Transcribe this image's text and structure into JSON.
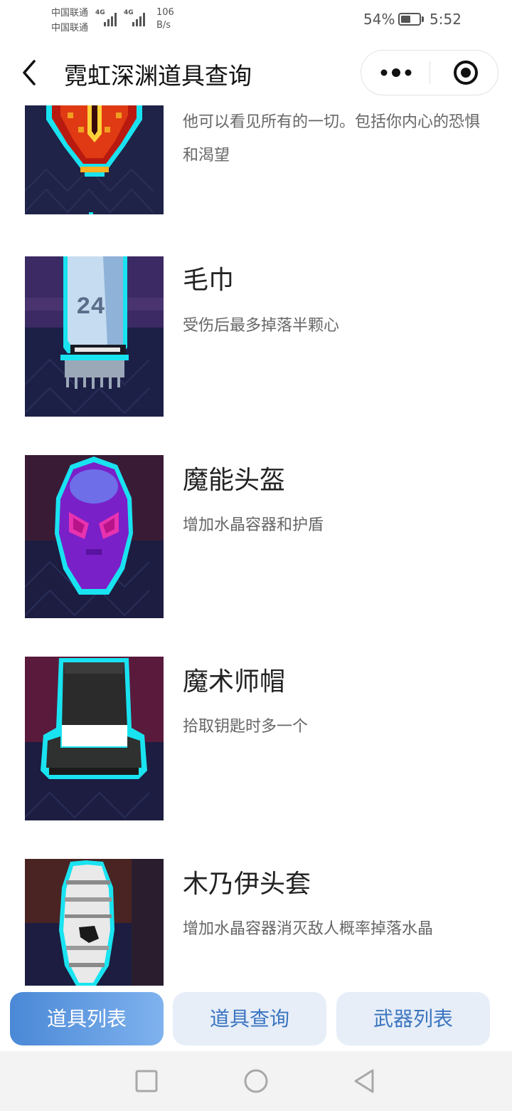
{
  "status_bar": {
    "carrier_1": "中国联通",
    "carrier_2": "中国联通",
    "network_1": "4G",
    "network_2": "4G",
    "net_speed_value": "106",
    "net_speed_unit": "B/s",
    "battery_percent": "54%",
    "battery_level": 0.54,
    "time": "5:52"
  },
  "nav": {
    "title": "霓虹深渊道具查询",
    "icons": {
      "back": "chevron-left-icon",
      "more": "more-dots-icon",
      "close": "target-circle-icon"
    }
  },
  "items": [
    {
      "name": "",
      "description": "他可以看见所有的一切。包括你内心的恐惧和渴望",
      "icon": "crimson-eye-crown-item",
      "bg_top": "#1f2347",
      "bg_bottom": "#1f2347"
    },
    {
      "name": "毛巾",
      "description": "受伤后最多掉落半颗心",
      "icon": "towel-item",
      "bg_top": "#3b2a63",
      "bg_bottom": "#1d2046"
    },
    {
      "name": "魔能头盔",
      "description": "增加水晶容器和护盾",
      "icon": "purple-helmet-item",
      "bg_top": "#3a1b36",
      "bg_bottom": "#1c1d40"
    },
    {
      "name": "魔术师帽",
      "description": "拾取钥匙时多一个",
      "icon": "magician-hat-item",
      "bg_top": "#5a1a3c",
      "bg_bottom": "#1c1d40"
    },
    {
      "name": "木乃伊头套",
      "description": "增加水晶容器消灭敌人概率掉落水晶",
      "icon": "mummy-mask-item",
      "bg_top": "#4a2323",
      "bg_bottom": "#1c1d40"
    }
  ],
  "tabs": [
    {
      "label": "道具列表",
      "active": true
    },
    {
      "label": "道具查询",
      "active": false
    },
    {
      "label": "武器列表",
      "active": false
    }
  ],
  "system_nav": {
    "icons": [
      "square-recents-icon",
      "circle-home-icon",
      "triangle-back-icon"
    ]
  },
  "colors": {
    "accent": "#4a88d6",
    "tab_inactive_bg": "#e7eef8",
    "tab_inactive_text": "#3b75c0",
    "neon_outline": "#19e3f0"
  }
}
